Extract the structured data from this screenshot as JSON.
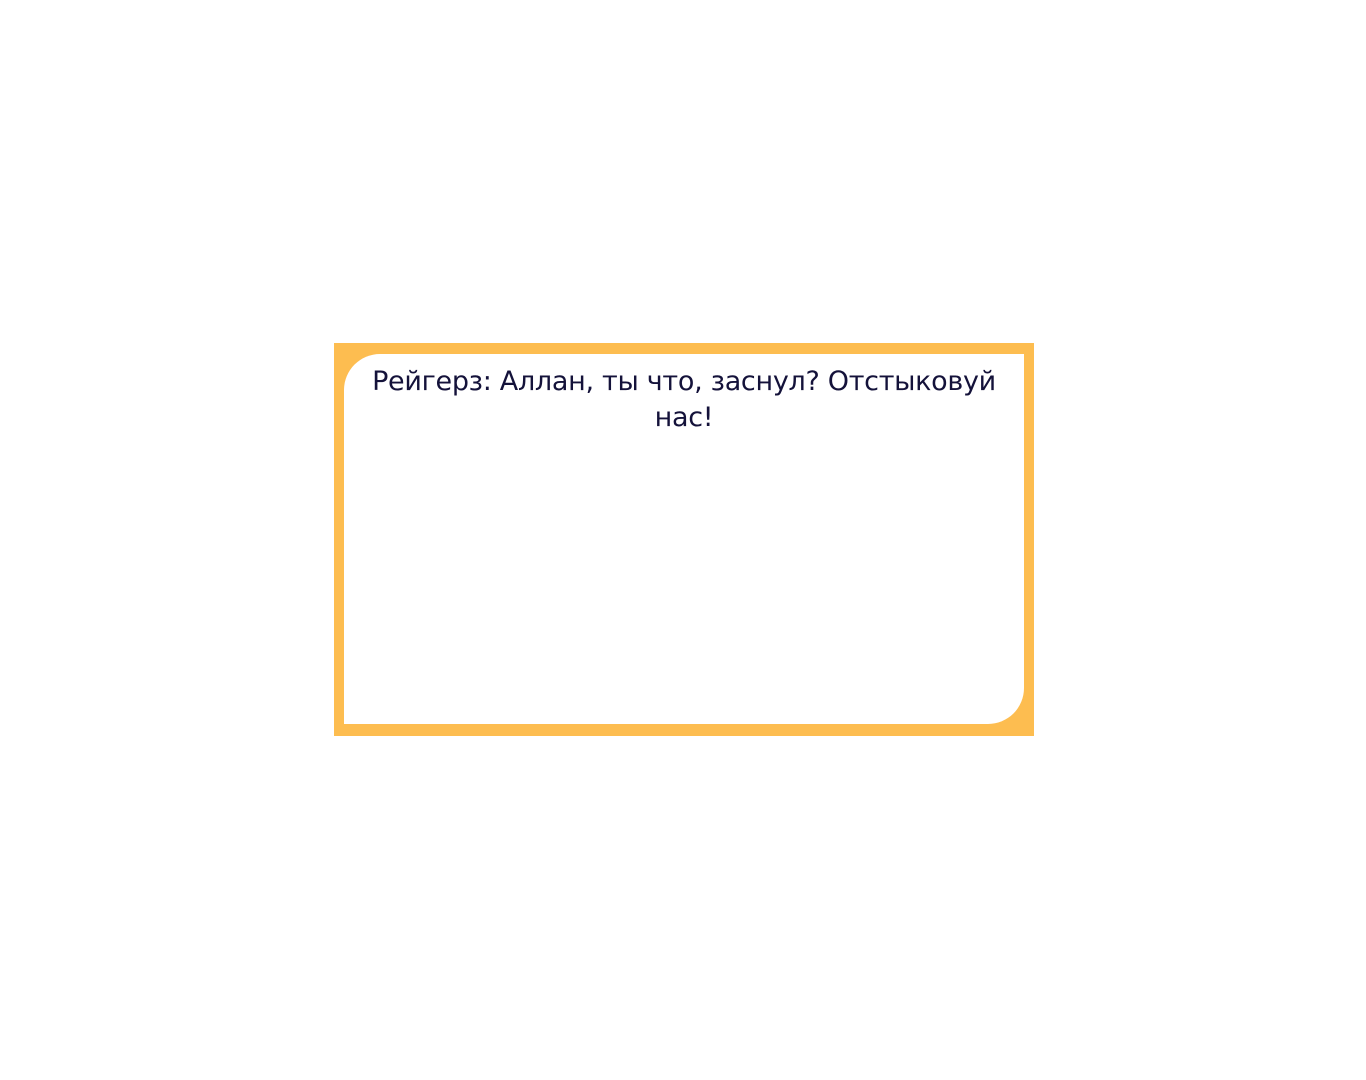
{
  "dialog": {
    "speaker": "Рейгерз",
    "line": "Рейгерз: Аллан, ты что, заснул? Отстыковуй нас!"
  },
  "colors": {
    "frame": "#fdbd50",
    "panel": "#ffffff",
    "text": "#14123a"
  }
}
